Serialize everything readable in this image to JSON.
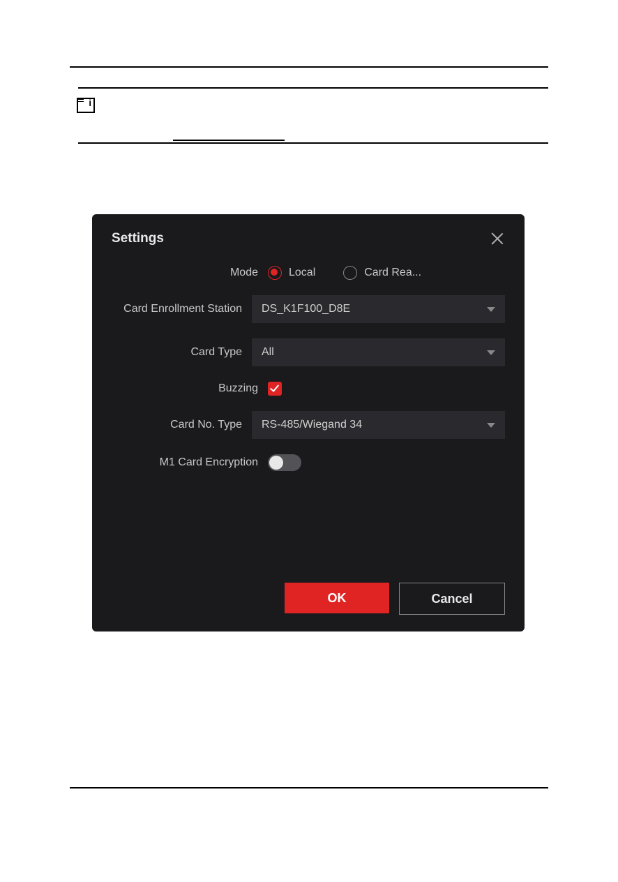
{
  "dialog": {
    "title": "Settings",
    "mode": {
      "label": "Mode",
      "options": {
        "local": "Local",
        "card_reader": "Card Rea..."
      },
      "selected": "local"
    },
    "enrollment_station": {
      "label": "Card Enrollment Station",
      "value": "DS_K1F100_D8E"
    },
    "card_type": {
      "label": "Card Type",
      "value": "All"
    },
    "buzzing": {
      "label": "Buzzing",
      "checked": true
    },
    "card_no_type": {
      "label": "Card No. Type",
      "value": "RS-485/Wiegand 34"
    },
    "m1_encryption": {
      "label": "M1 Card Encryption",
      "enabled": false
    },
    "buttons": {
      "ok": "OK",
      "cancel": "Cancel"
    }
  }
}
